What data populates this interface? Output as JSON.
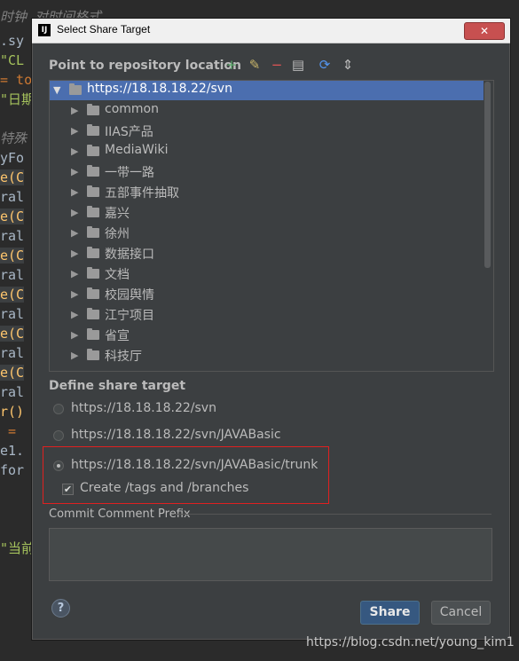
{
  "editor": {
    "lines": [
      {
        "text": "时钟 对时间格式",
        "cls": "c-com"
      },
      {
        "text": ".sy",
        "cls": "c-def"
      },
      {
        "text": "\"CL",
        "cls": "c-str"
      },
      {
        "text": "= to",
        "cls": "c-op"
      },
      {
        "text": "\"日期",
        "cls": "c-str"
      },
      {
        "text": "",
        "cls": "c-def"
      },
      {
        "text": "特殊",
        "cls": "c-com"
      },
      {
        "text": "yFo",
        "cls": "c-def"
      },
      {
        "text": "e(C",
        "cls": "c-fn"
      },
      {
        "text": "ral",
        "cls": "c-def"
      },
      {
        "text": "e(C",
        "cls": "c-fn"
      },
      {
        "text": "ral",
        "cls": "c-def"
      },
      {
        "text": "e(C",
        "cls": "c-fn"
      },
      {
        "text": "ral",
        "cls": "c-def"
      },
      {
        "text": "e(C",
        "cls": "c-fn"
      },
      {
        "text": "ral",
        "cls": "c-def"
      },
      {
        "text": "e(C",
        "cls": "c-fn"
      },
      {
        "text": "ral",
        "cls": "c-def"
      },
      {
        "text": "e(C",
        "cls": "c-fn"
      },
      {
        "text": "ral",
        "cls": "c-def"
      },
      {
        "text": "r()",
        "cls": "c-fn"
      },
      {
        "text": " =",
        "cls": "c-op"
      },
      {
        "text": "e1.",
        "cls": "c-def"
      },
      {
        "text": "for",
        "cls": "c-def"
      },
      {
        "text": "",
        "cls": "c-def"
      },
      {
        "text": "",
        "cls": "c-def"
      },
      {
        "text": "\"当前",
        "cls": "c-str"
      }
    ]
  },
  "dialog": {
    "app_icon": "IJ",
    "title": "Select Share Target",
    "close_symbol": "✕",
    "repo_section_label": "Point to repository location",
    "toolbar": [
      {
        "name": "add-icon",
        "glyph": "+",
        "color": "#59a869"
      },
      {
        "name": "edit-icon",
        "glyph": "✎",
        "color": "#c9b56a"
      },
      {
        "name": "remove-icon",
        "glyph": "−",
        "color": "#e05555"
      },
      {
        "name": "details-icon",
        "glyph": "▤",
        "color": "#bbbbbb"
      },
      {
        "name": "refresh-icon",
        "glyph": "⟳",
        "color": "#5394ec"
      },
      {
        "name": "collapse-icon",
        "glyph": "⇕",
        "color": "#bbbbbb"
      }
    ],
    "tree": {
      "root": "https://18.18.18.22/svn",
      "children": [
        "common",
        "IIAS产品",
        "MediaWiki",
        "一带一路",
        "五部事件抽取",
        "嘉兴",
        "徐州",
        "数据接口",
        "文档",
        "校园舆情",
        "江宁项目",
        "省宣",
        "科技厅"
      ]
    },
    "share_section_label": "Define share target",
    "targets": [
      {
        "label": "https://18.18.18.22/svn",
        "checked": false
      },
      {
        "label": "https://18.18.18.22/svn/JAVABasic",
        "checked": false
      },
      {
        "label": "https://18.18.18.22/svn/JAVABasic/trunk",
        "checked": true
      }
    ],
    "create_tags_label": "Create /tags and /branches",
    "create_tags_checked": true,
    "commit_prefix_label": "Commit Comment Prefix",
    "commit_prefix_value": "",
    "help_label": "?",
    "share_button": "Share",
    "cancel_button": "Cancel"
  },
  "watermark": "https://blog.csdn.net/young_kim1",
  "colors": {
    "accent": "#4b6eaf",
    "highlight_box": "#e02020",
    "primary_button": "#365880"
  }
}
